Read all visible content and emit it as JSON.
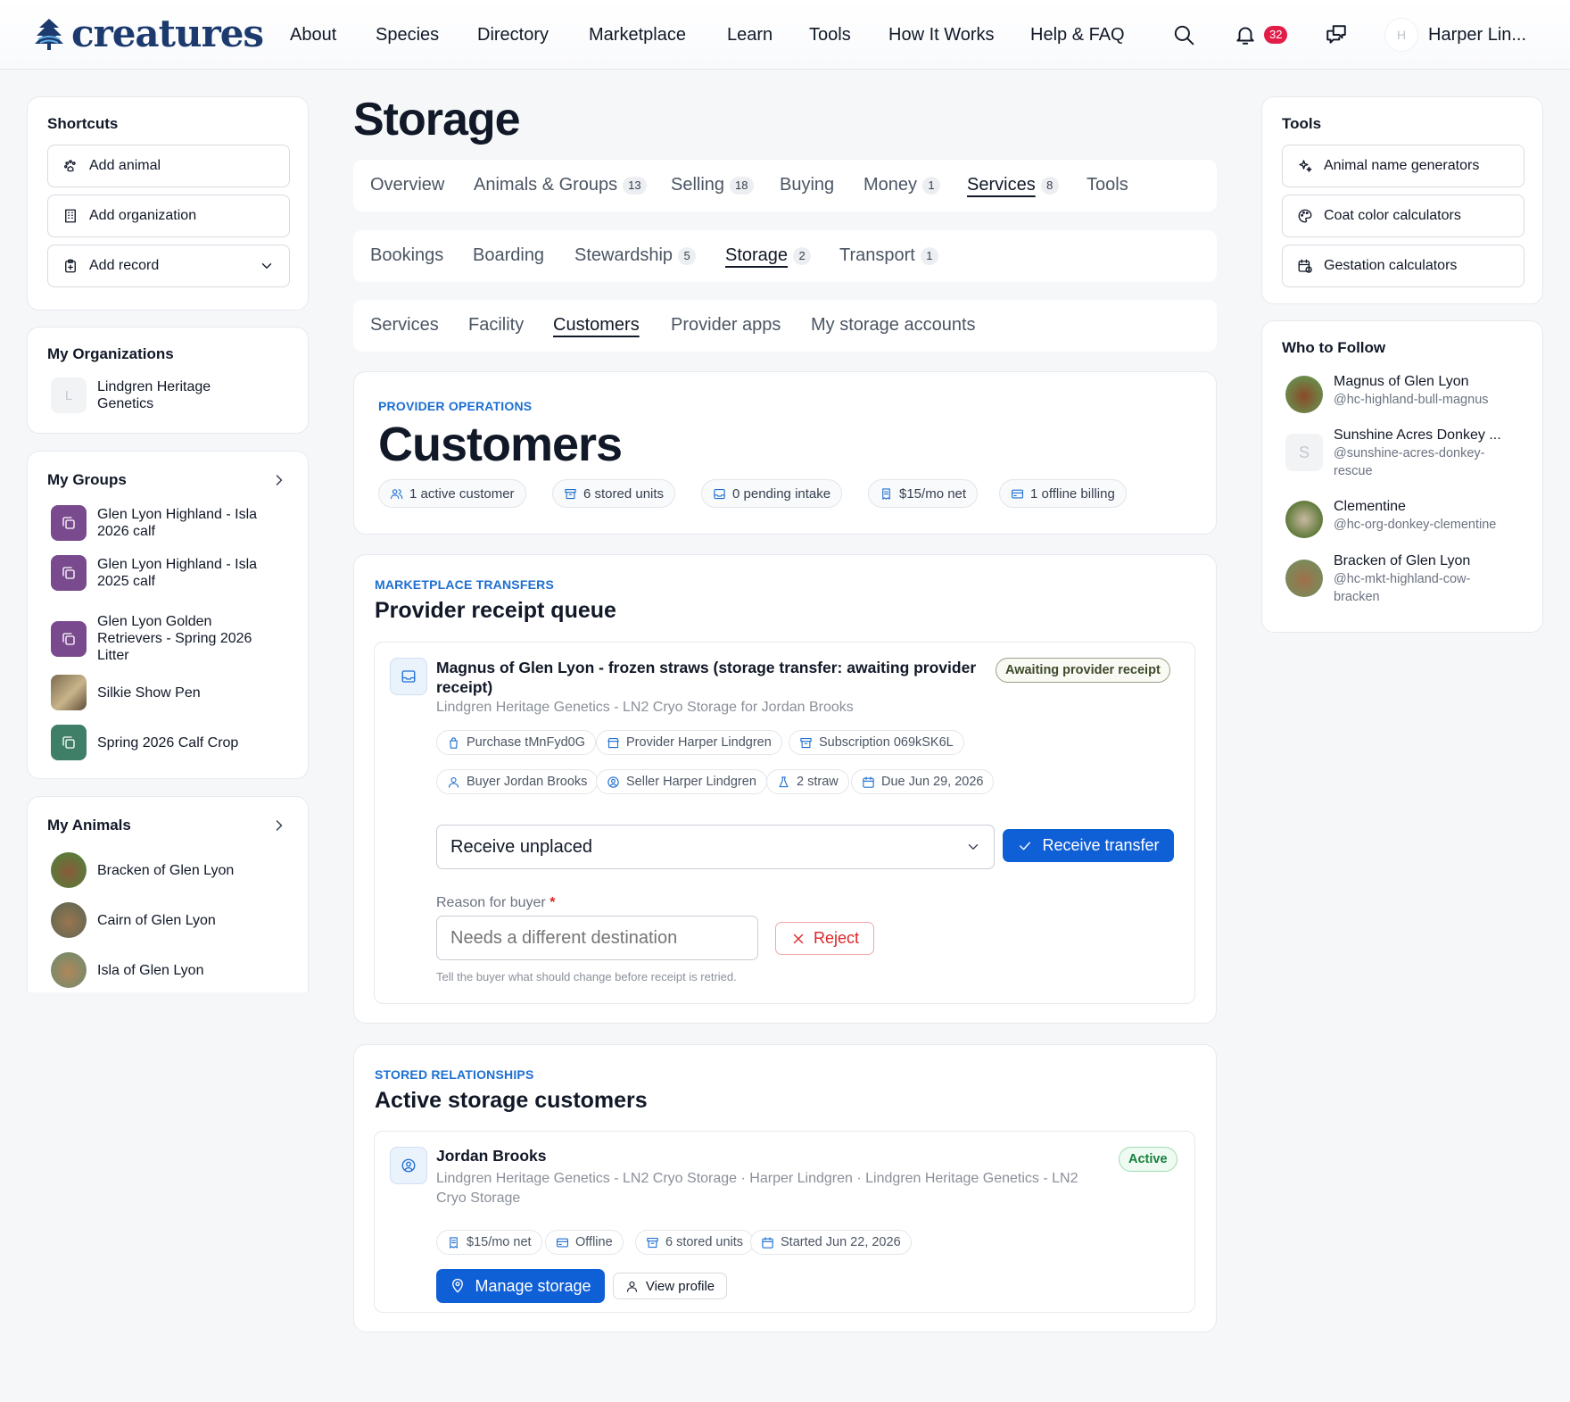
{
  "header": {
    "brand": "creatures",
    "nav": [
      "About",
      "Species",
      "Directory",
      "Marketplace",
      "Learn",
      "Tools",
      "How It Works",
      "Help & FAQ"
    ],
    "notification_count": "32",
    "user_initial": "H",
    "user_name": "Harper Lin..."
  },
  "shortcuts": {
    "title": "Shortcuts",
    "add_animal": "Add animal",
    "add_organization": "Add organization",
    "add_record": "Add record"
  },
  "organizations": {
    "title": "My Organizations",
    "items": [
      {
        "initial": "L",
        "name": "Lindgren Heritage Genetics"
      }
    ]
  },
  "groups": {
    "title": "My Groups",
    "items": [
      "Glen Lyon Highland - Isla 2026 calf",
      "Glen Lyon Highland - Isla 2025 calf",
      "Glen Lyon Golden Retrievers - Spring 2026 Litter",
      "Silkie Show Pen",
      "Spring 2026 Calf Crop"
    ]
  },
  "animals": {
    "title": "My Animals",
    "items": [
      "Bracken of Glen Lyon",
      "Cairn of Glen Lyon",
      "Isla of Glen Lyon"
    ]
  },
  "page": {
    "title": "Storage"
  },
  "tabs_primary": [
    {
      "label": "Overview"
    },
    {
      "label": "Animals & Groups",
      "count": "13"
    },
    {
      "label": "Selling",
      "count": "18"
    },
    {
      "label": "Buying"
    },
    {
      "label": "Money",
      "count": "1"
    },
    {
      "label": "Services",
      "count": "8"
    },
    {
      "label": "Tools"
    }
  ],
  "tabs_secondary": [
    {
      "label": "Bookings"
    },
    {
      "label": "Boarding"
    },
    {
      "label": "Stewardship",
      "count": "5"
    },
    {
      "label": "Storage",
      "count": "2"
    },
    {
      "label": "Transport",
      "count": "1"
    }
  ],
  "tabs_tertiary": [
    "Services",
    "Facility",
    "Customers",
    "Provider apps",
    "My storage accounts"
  ],
  "customers_header": {
    "eyebrow": "PROVIDER OPERATIONS",
    "title": "Customers",
    "stats": [
      "1 active customer",
      "6 stored units",
      "0 pending intake",
      "$15/mo net",
      "1 offline billing"
    ]
  },
  "receipt_queue": {
    "eyebrow": "MARKETPLACE TRANSFERS",
    "title": "Provider receipt queue",
    "item": {
      "title_line1": "Magnus of Glen Lyon - frozen straws (storage transfer: awaiting provider",
      "title_line2": "receipt)",
      "subtitle": "Lindgren Heritage Genetics - LN2 Cryo Storage for Jordan Brooks",
      "status": "Awaiting provider receipt",
      "meta_row1": [
        "Purchase tMnFyd0G",
        "Provider Harper Lindgren",
        "Subscription 069kSK6L"
      ],
      "meta_row2": [
        "Buyer Jordan Brooks",
        "Seller Harper Lindgren",
        "2 straw",
        "Due Jun 29, 2026"
      ],
      "select_value": "Receive unplaced",
      "receive_label": "Receive transfer",
      "reason_label": "Reason for buyer",
      "required_mark": "*",
      "reason_placeholder": "Needs a different destination",
      "reject_label": "Reject",
      "helper": "Tell the buyer what should change before receipt is retried."
    }
  },
  "active_customers": {
    "eyebrow": "STORED RELATIONSHIPS",
    "title": "Active storage customers",
    "item": {
      "name": "Jordan Brooks",
      "status": "Active",
      "detail_line1": "Lindgren Heritage Genetics - LN2 Cryo Storage · Harper Lindgren · Lindgren Heritage Genetics - LN2",
      "detail_line2": "Cryo Storage",
      "meta": [
        "$15/mo net",
        "Offline",
        "6 stored units",
        "Started Jun 22, 2026"
      ],
      "manage_label": "Manage storage",
      "profile_label": "View profile"
    }
  },
  "tools": {
    "title": "Tools",
    "items": [
      "Animal name generators",
      "Coat color calculators",
      "Gestation calculators"
    ]
  },
  "follow": {
    "title": "Who to Follow",
    "items": [
      {
        "name": "Magnus of Glen Lyon",
        "handle_line1": "@hc-highland-bull-magnus",
        "handle_line2": ""
      },
      {
        "name": "Sunshine Acres Donkey ...",
        "initial": "S",
        "handle_line1": "@sunshine-acres-donkey-",
        "handle_line2": "rescue"
      },
      {
        "name": "Clementine",
        "handle_line1": "@hc-org-donkey-clementine",
        "handle_line2": ""
      },
      {
        "name": "Bracken of Glen Lyon",
        "handle_line1": "@hc-mkt-highland-cow-",
        "handle_line2": "bracken"
      }
    ]
  },
  "colors": {
    "accent": "#0f5fd6",
    "eyebrow": "#1d6fd1",
    "danger": "#dc2626",
    "success": "#16a34a",
    "brand": "#1d3a6e"
  }
}
